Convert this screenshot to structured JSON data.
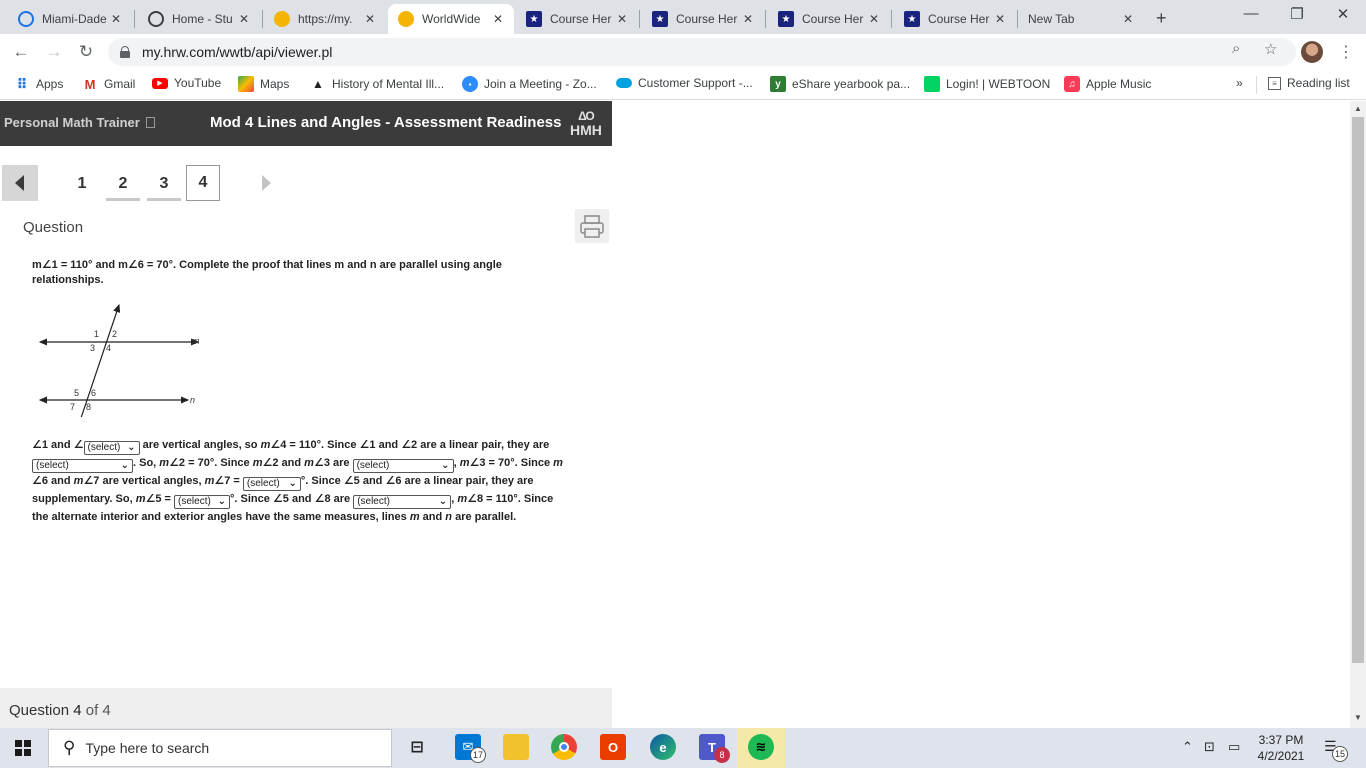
{
  "browser": {
    "tabs": [
      {
        "title": "Miami-Dade",
        "icon": "clock-globe-icon",
        "color": "#1a73e8"
      },
      {
        "title": "Home - Stu",
        "icon": "globe-icon",
        "color": "#3c4043"
      },
      {
        "title": "https://my.",
        "icon": "circle-icon",
        "color": "#f4b400"
      },
      {
        "title": "WorldWide",
        "icon": "circle-icon",
        "color": "#f4b400",
        "active": true
      },
      {
        "title": "Course Her",
        "icon": "star-shield-icon",
        "color": "#1a237e"
      },
      {
        "title": "Course Her",
        "icon": "star-shield-icon",
        "color": "#1a237e"
      },
      {
        "title": "Course Her",
        "icon": "star-shield-icon",
        "color": "#1a237e"
      },
      {
        "title": "Course Her",
        "icon": "star-shield-icon",
        "color": "#1a237e"
      },
      {
        "title": "New Tab",
        "icon": "",
        "color": ""
      }
    ],
    "close_glyph": "✕",
    "new_tab_glyph": "+",
    "window_controls": {
      "minimize": "—",
      "maximize": "❐",
      "close": "✕"
    },
    "url": "my.hrw.com/wwtb/api/viewer.pl",
    "bookmarks": [
      {
        "label": "Apps",
        "icon": "apps-grid-icon"
      },
      {
        "label": "Gmail",
        "icon": "gmail-icon"
      },
      {
        "label": "YouTube",
        "icon": "youtube-icon"
      },
      {
        "label": "Maps",
        "icon": "maps-icon"
      },
      {
        "label": "History of Mental Ill...",
        "icon": "bookmark-site-icon"
      },
      {
        "label": "Join a Meeting - Zo...",
        "icon": "zoom-icon"
      },
      {
        "label": "Customer Support -...",
        "icon": "cloud-icon"
      },
      {
        "label": "eShare yearbook pa...",
        "icon": "eshare-icon"
      },
      {
        "label": "Login! | WEBTOON",
        "icon": "webtoon-icon"
      },
      {
        "label": "Apple Music",
        "icon": "music-icon"
      }
    ],
    "more_bookmarks": "»",
    "reading_list": "Reading list"
  },
  "app": {
    "brand": "Personal Math Trainer",
    "title": "Mod 4 Lines and Angles - Assessment Readiness",
    "logo_top": "ΔΟ",
    "logo_bottom": "HMH"
  },
  "question_nav": {
    "numbers": [
      "1",
      "2",
      "3",
      "4"
    ],
    "current": "4"
  },
  "question": {
    "label": "Question",
    "prompt_line1": "m∠1 = 110° and m∠6 = 70°. Complete the proof that lines m and n are parallel using angle",
    "prompt_line2": "relationships.",
    "diagram_labels": {
      "a1": "1",
      "a2": "2",
      "a3": "3",
      "a4": "4",
      "a5": "5",
      "a6": "6",
      "a7": "7",
      "a8": "8",
      "line_m": "m",
      "line_n": "n"
    },
    "proof": {
      "t1": "∠1 and ∠",
      "s1": "(select)",
      "t2": " are vertical angles, so ",
      "t2b": "m",
      "t2c": "∠4 = 110°. Since ∠1 and ∠2 are a linear pair, they are",
      "s2": "(select)",
      "t3a": ". So, ",
      "t3b": "m",
      "t3c": "∠2 = 70°. Since ",
      "t3d": "m",
      "t3e": "∠2 and ",
      "t3f": "m",
      "t3g": "∠3 are ",
      "s3": "(select)",
      "t4a": ", ",
      "t4b": "m",
      "t4c": "∠3 = 70°. Since ",
      "t4d": "m",
      "t5a": "∠6 and ",
      "t5b": "m",
      "t5c": "∠7 are vertical angles, ",
      "t5d": "m",
      "t5e": "∠7 = ",
      "s4": "(select)",
      "t5f": "°. Since ∠5 and ∠6 are a linear pair, they are",
      "t6a": "supplementary. So, ",
      "t6b": "m",
      "t6c": "∠5 = ",
      "s5": "(select)",
      "t6d": "°. Since ∠5 and ∠8 are ",
      "s6": "(select)",
      "t6e": ", ",
      "t6f": "m",
      "t6g": "∠8 = 110°. Since",
      "t7a": "the alternate interior and exterior angles have the same measures, lines ",
      "t7b": "m",
      "t7c": " and ",
      "t7d": "n",
      "t7e": " are parallel."
    },
    "footer_prefix": "Question",
    "footer_num": "4",
    "footer_suffix": "of 4"
  },
  "taskbar": {
    "search_placeholder": "Type here to search",
    "mail_badge": "17",
    "teams_badge": "8",
    "time": "3:37 PM",
    "date": "4/2/2021",
    "notif_badge": "15"
  }
}
